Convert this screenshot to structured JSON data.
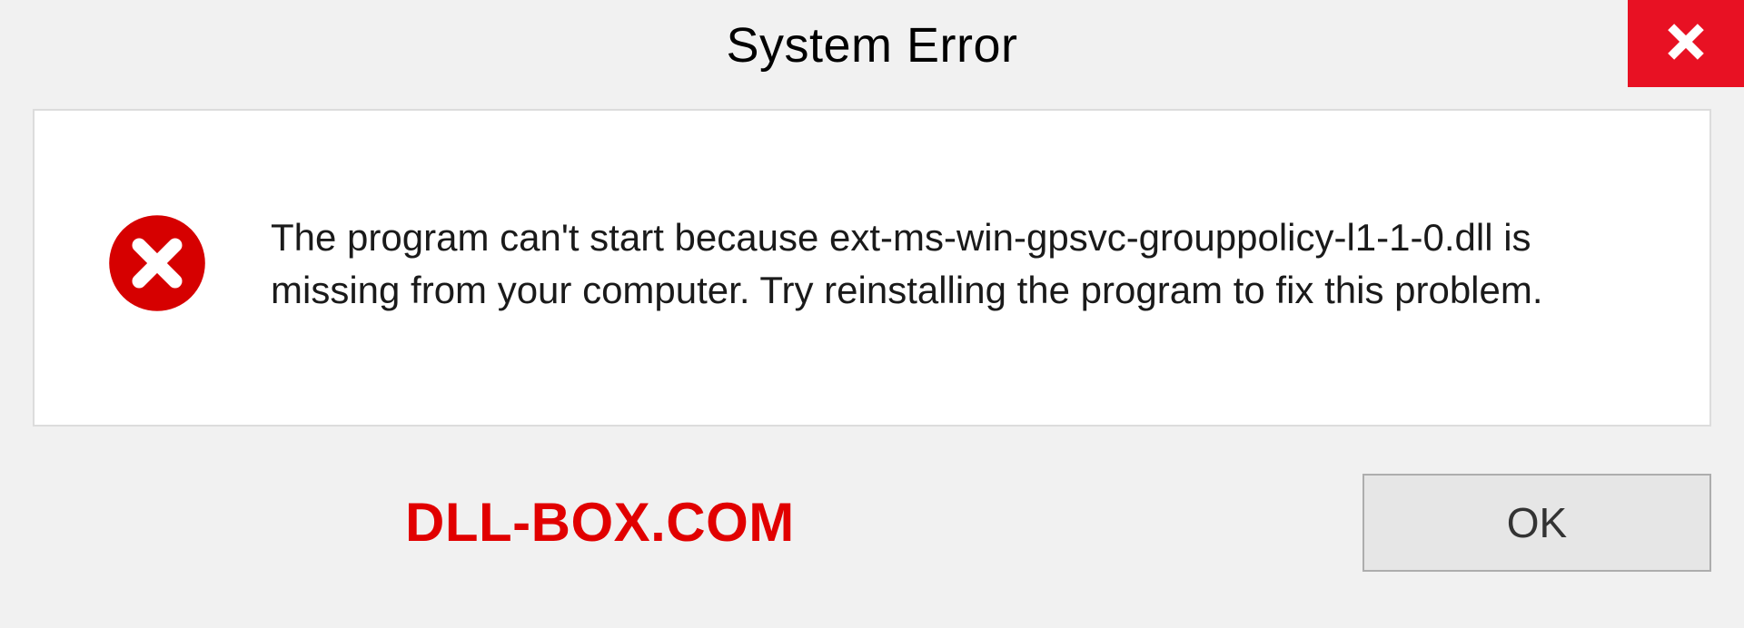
{
  "header": {
    "title": "System Error"
  },
  "dialog": {
    "message": "The program can't start because ext-ms-win-gpsvc-grouppolicy-l1-1-0.dll is missing from your computer. Try reinstalling the program to fix this problem."
  },
  "footer": {
    "brand": "DLL-BOX.COM",
    "ok_label": "OK"
  },
  "colors": {
    "close_red": "#e81123",
    "brand_red": "#e10000",
    "error_red": "#d60000"
  }
}
